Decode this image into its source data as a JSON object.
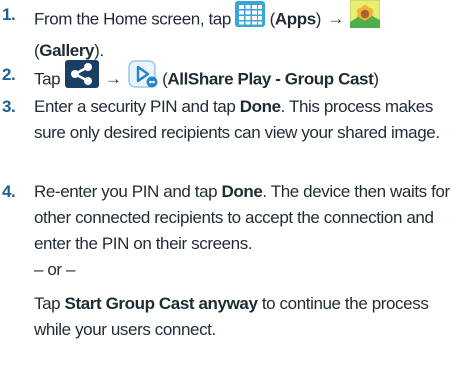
{
  "steps": [
    {
      "number": "1.",
      "t1": "From the Home screen, tap ",
      "apps": "Apps",
      "gallery": "Gallery"
    },
    {
      "number": "2.",
      "t1": "Tap ",
      "allshare": "AllShare Play - Group Cast"
    },
    {
      "number": "3.",
      "t1": "Enter a security PIN and tap ",
      "done": "Done",
      "t2": ". This process makes sure only desired recipients can view your shared image."
    },
    {
      "number": "4.",
      "t1": "Re-enter you PIN and tap ",
      "done": "Done",
      "t2": ". The device then waits for other connected recipients to accept the connection and enter the PIN on their screens.",
      "or": "– or –",
      "t3": "Tap ",
      "start": "Start Group Cast anyway",
      "t4": " to continue the process while your users connect."
    }
  ],
  "symbols": {
    "arrow": "→",
    "lparen": "(",
    "rparen": ")",
    "rparen_period": ").",
    "space_lparen": " ("
  },
  "icons": {
    "apps": "apps-grid-icon",
    "gallery": "gallery-icon",
    "share": "share-icon",
    "allshare": "allshare-play-icon"
  },
  "colors": {
    "number": "#1f5f93",
    "text": "#1f2c33",
    "apps_icon": "#3aa3d8",
    "share_icon": "#1a3f66"
  }
}
